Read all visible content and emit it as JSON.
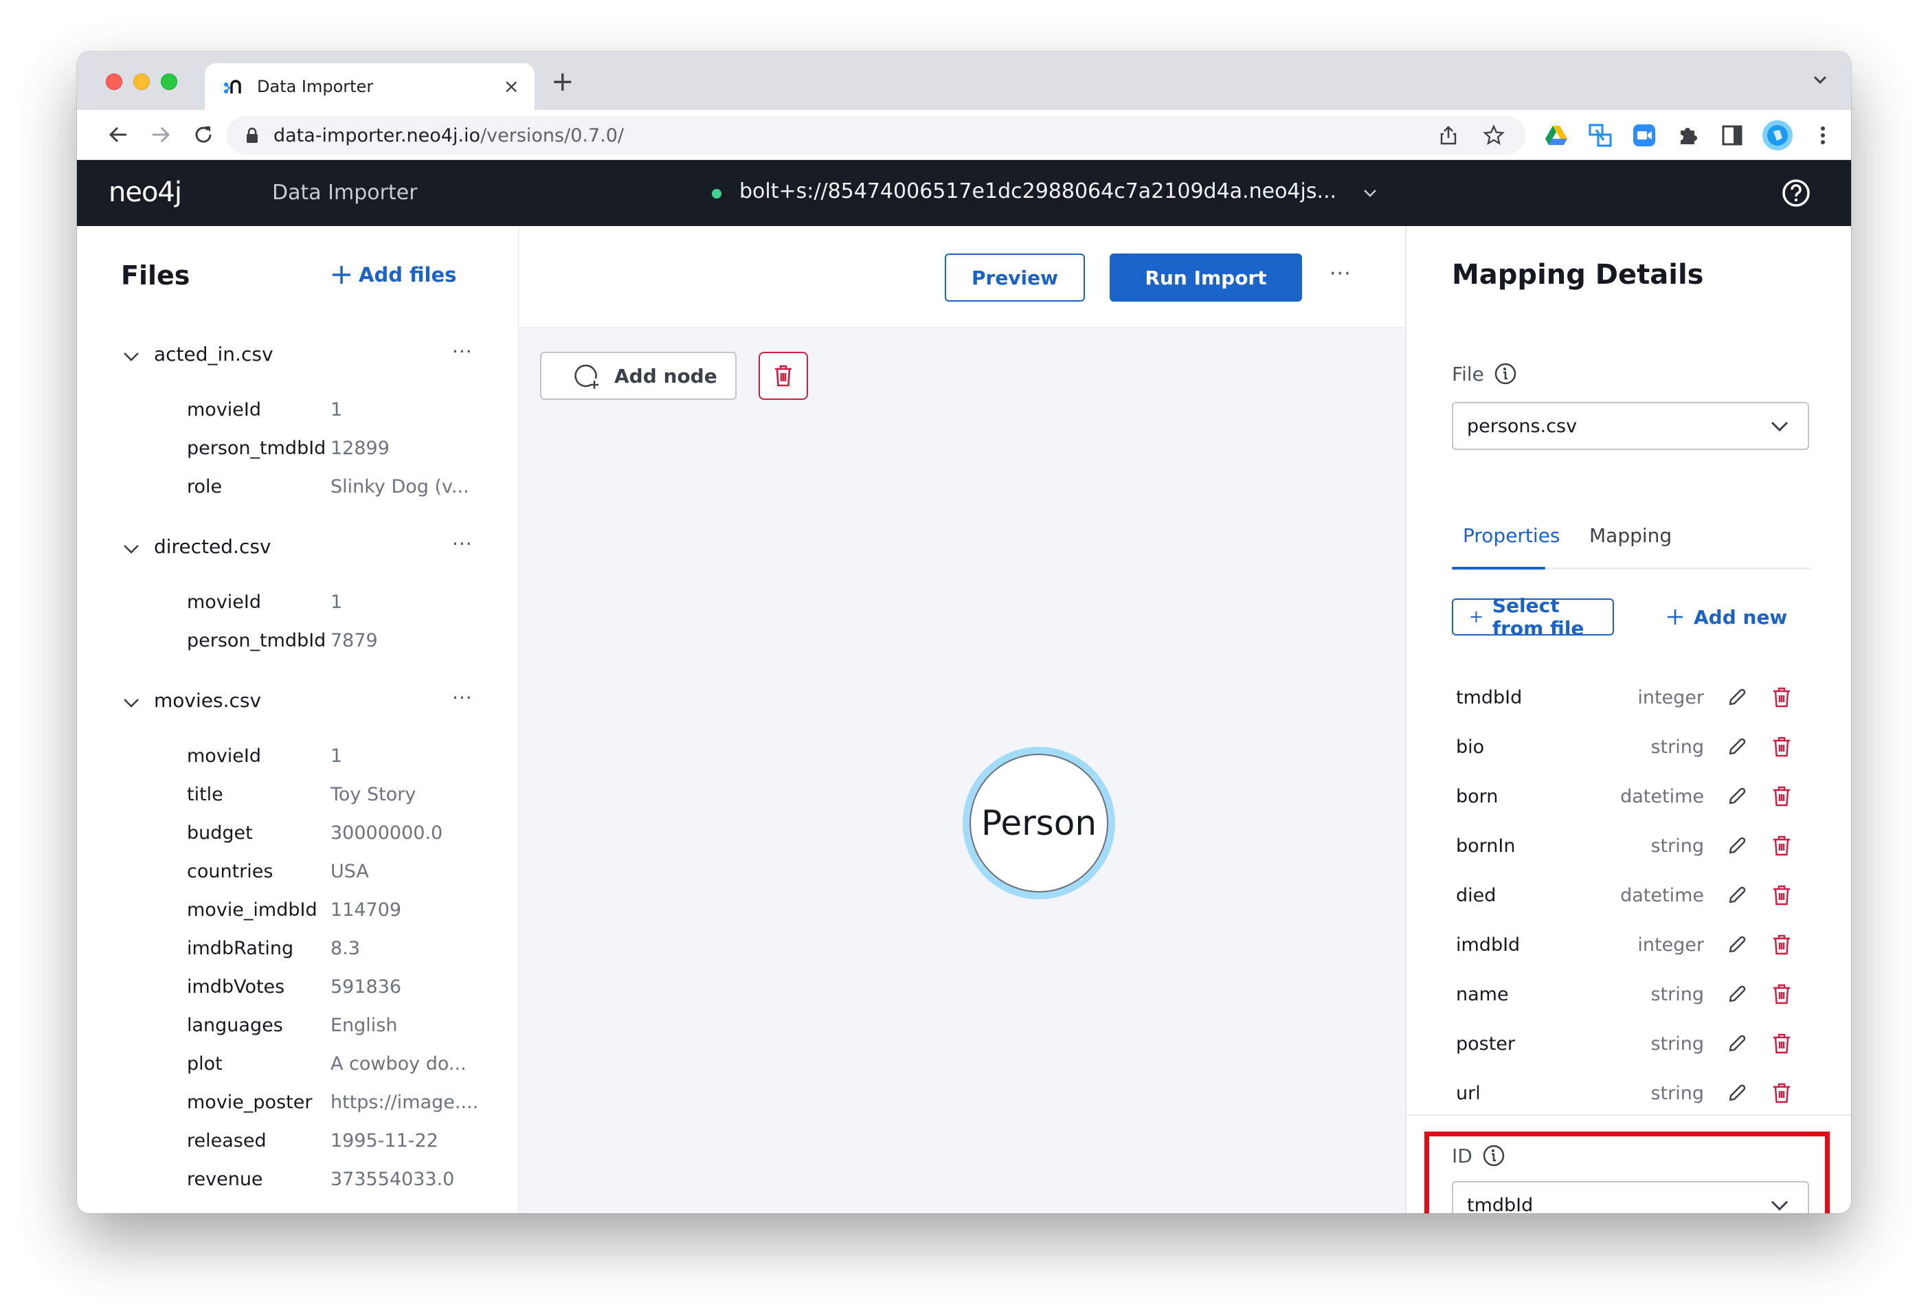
{
  "browser": {
    "tab": {
      "title": "Data Importer",
      "close_label": "×",
      "favicon": "neo4j-favicon-icon"
    },
    "new_tab_label": "+",
    "url": {
      "host": "data-importer.neo4j.io",
      "path": "/versions/0.7.0/"
    },
    "toolbar_icons": [
      "back-icon",
      "forward-icon",
      "reload-icon",
      "share-icon",
      "bookmark-star-icon",
      "google-drive-icon",
      "screen-share-extension-icon",
      "zoom-extension-icon",
      "extensions-puzzle-icon",
      "sidebar-icon",
      "profile-avatar-icon",
      "browser-menu-icon"
    ]
  },
  "app": {
    "logo": "neo4j",
    "title": "Data Importer",
    "connection": {
      "url": "bolt+s://85474006517e1dc2988064c7a2109d4a.neo4js...",
      "status": "connected",
      "status_color": "#3fd18f"
    },
    "help_icon": "help-icon"
  },
  "files_panel": {
    "title": "Files",
    "add_files_label": "Add files",
    "more_label": "···",
    "files": [
      {
        "name": "acted_in.csv",
        "rows": [
          {
            "key": "movieId",
            "value": "1"
          },
          {
            "key": "person_tmdbId",
            "value": "12899"
          },
          {
            "key": "role",
            "value": "Slinky Dog (v..."
          }
        ]
      },
      {
        "name": "directed.csv",
        "rows": [
          {
            "key": "movieId",
            "value": "1"
          },
          {
            "key": "person_tmdbId",
            "value": "7879"
          }
        ]
      },
      {
        "name": "movies.csv",
        "rows": [
          {
            "key": "movieId",
            "value": "1"
          },
          {
            "key": "title",
            "value": "Toy Story"
          },
          {
            "key": "budget",
            "value": "30000000.0"
          },
          {
            "key": "countries",
            "value": "USA"
          },
          {
            "key": "movie_imdbId",
            "value": "114709"
          },
          {
            "key": "imdbRating",
            "value": "8.3"
          },
          {
            "key": "imdbVotes",
            "value": "591836"
          },
          {
            "key": "languages",
            "value": "English"
          },
          {
            "key": "plot",
            "value": "A cowboy do..."
          },
          {
            "key": "movie_poster",
            "value": "https://image...."
          },
          {
            "key": "released",
            "value": "1995-11-22"
          },
          {
            "key": "revenue",
            "value": "373554033.0"
          }
        ]
      }
    ]
  },
  "canvas": {
    "preview_label": "Preview",
    "run_import_label": "Run Import",
    "more_label": "···",
    "add_node_label": "Add node",
    "node": {
      "label": "Person",
      "ring_color": "#a3dcfa"
    }
  },
  "mapping_panel": {
    "title": "Mapping Details",
    "file_label": "File",
    "file_value": "persons.csv",
    "tabs": [
      {
        "label": "Properties",
        "active": true
      },
      {
        "label": "Mapping",
        "active": false
      }
    ],
    "select_from_file_label": "Select from file",
    "add_new_label": "Add new",
    "properties": [
      {
        "name": "tmdbId",
        "type": "integer"
      },
      {
        "name": "bio",
        "type": "string"
      },
      {
        "name": "born",
        "type": "datetime"
      },
      {
        "name": "bornIn",
        "type": "string"
      },
      {
        "name": "died",
        "type": "datetime"
      },
      {
        "name": "imdbId",
        "type": "integer"
      },
      {
        "name": "name",
        "type": "string"
      },
      {
        "name": "poster",
        "type": "string"
      },
      {
        "name": "url",
        "type": "string"
      }
    ],
    "id_label": "ID",
    "id_value": "tmdbId",
    "highlight_color": "#e30b17"
  },
  "colors": {
    "primary": "#1a63c9",
    "danger": "#cc1d43",
    "header_bg": "#171c24",
    "canvas_bg": "#f4f5f8"
  }
}
